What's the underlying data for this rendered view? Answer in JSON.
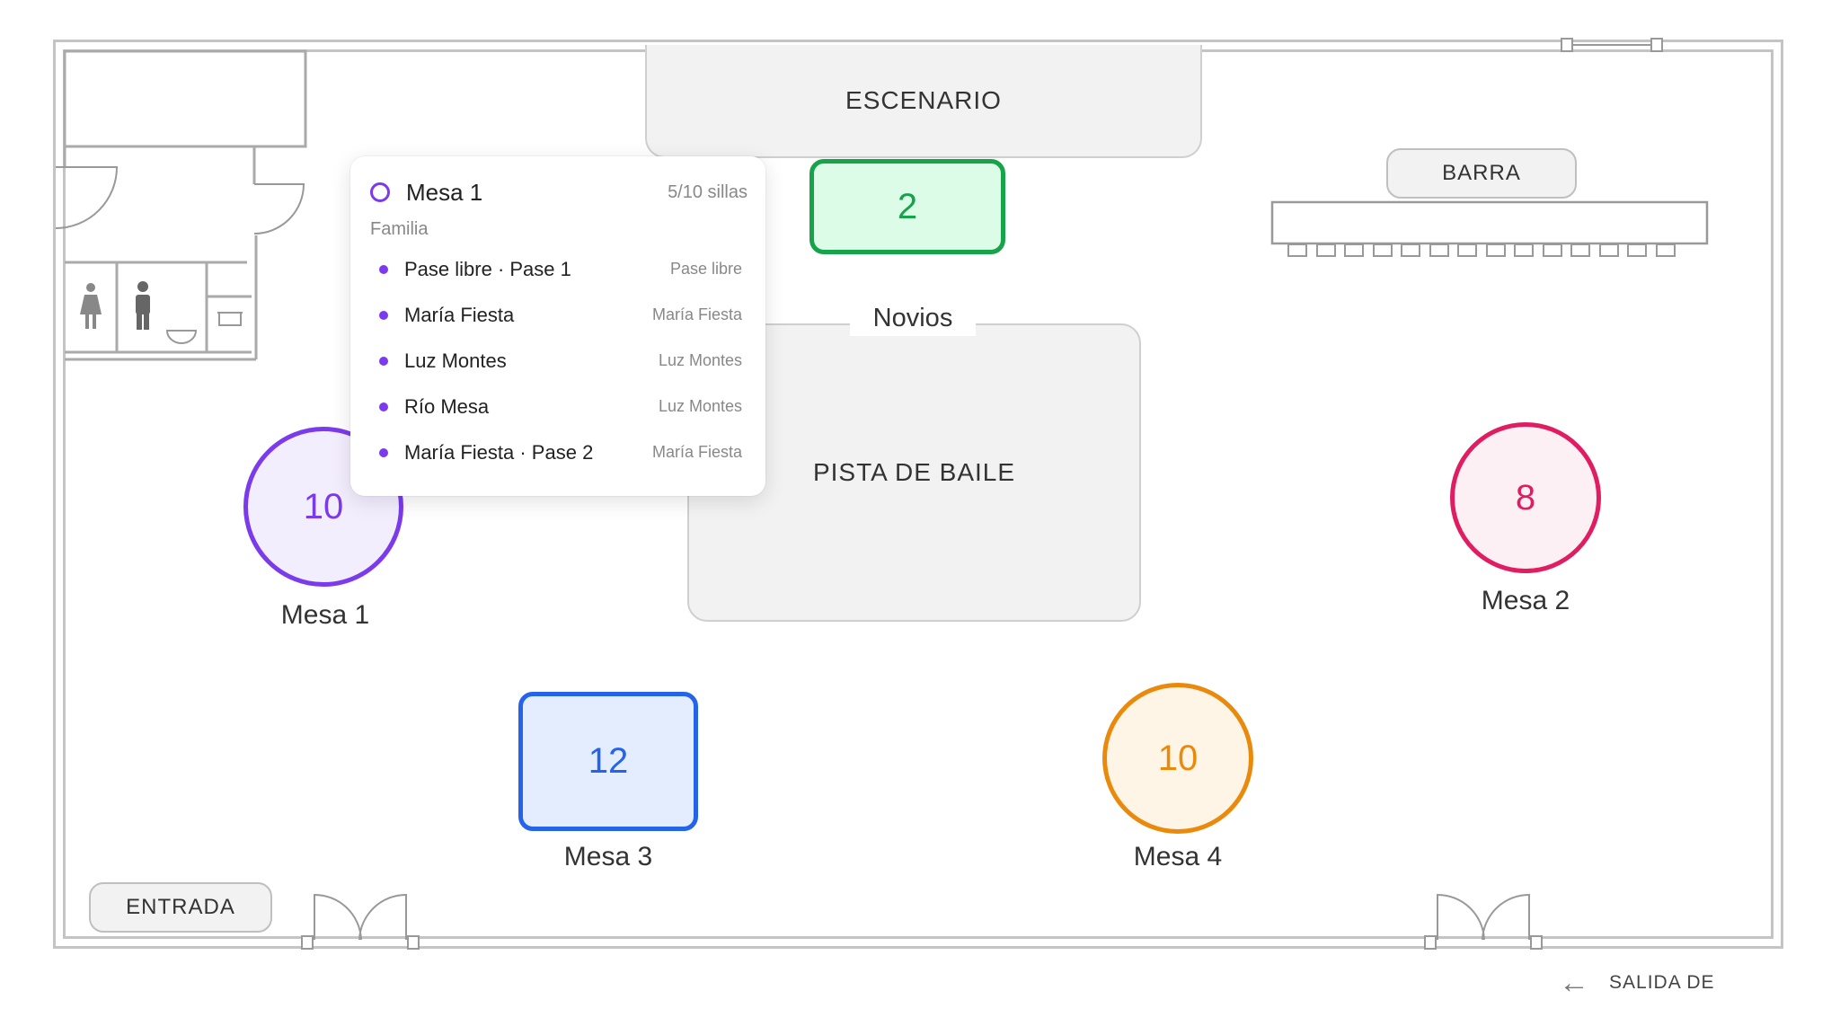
{
  "zones": {
    "stage": "ESCENARIO",
    "bar": "BARRA",
    "dance_floor": "PISTA DE BAILE",
    "sweetheart_label": "Novios",
    "entrance": "ENTRADA",
    "exit": "SALIDA DE"
  },
  "tables": {
    "mesa1": {
      "name": "Mesa 1",
      "seats": "10",
      "color": "#7c3aed"
    },
    "novios": {
      "seats": "2",
      "color": "#16a34a"
    },
    "mesa2": {
      "name": "Mesa 2",
      "seats": "8",
      "color": "#e11d62"
    },
    "mesa3": {
      "name": "Mesa 3",
      "seats": "12",
      "color": "#2563eb"
    },
    "mesa4": {
      "name": "Mesa 4",
      "seats": "10",
      "color": "#ea8a0c"
    }
  },
  "popup": {
    "title": "Mesa 1",
    "seats_label": "5/10 sillas",
    "group": "Familia",
    "guests": [
      {
        "name": "Pase libre · Pase 1",
        "tag": "Pase libre"
      },
      {
        "name": "María Fiesta",
        "tag": "María Fiesta"
      },
      {
        "name": "Luz Montes",
        "tag": "Luz Montes"
      },
      {
        "name": "Río Mesa",
        "tag": "Luz Montes"
      },
      {
        "name": "María Fiesta · Pase 2",
        "tag": "María Fiesta"
      }
    ]
  },
  "icons": {
    "restroom_women": "woman-icon",
    "restroom_men": "man-icon",
    "exit_arrow": "arrow-left-icon"
  }
}
